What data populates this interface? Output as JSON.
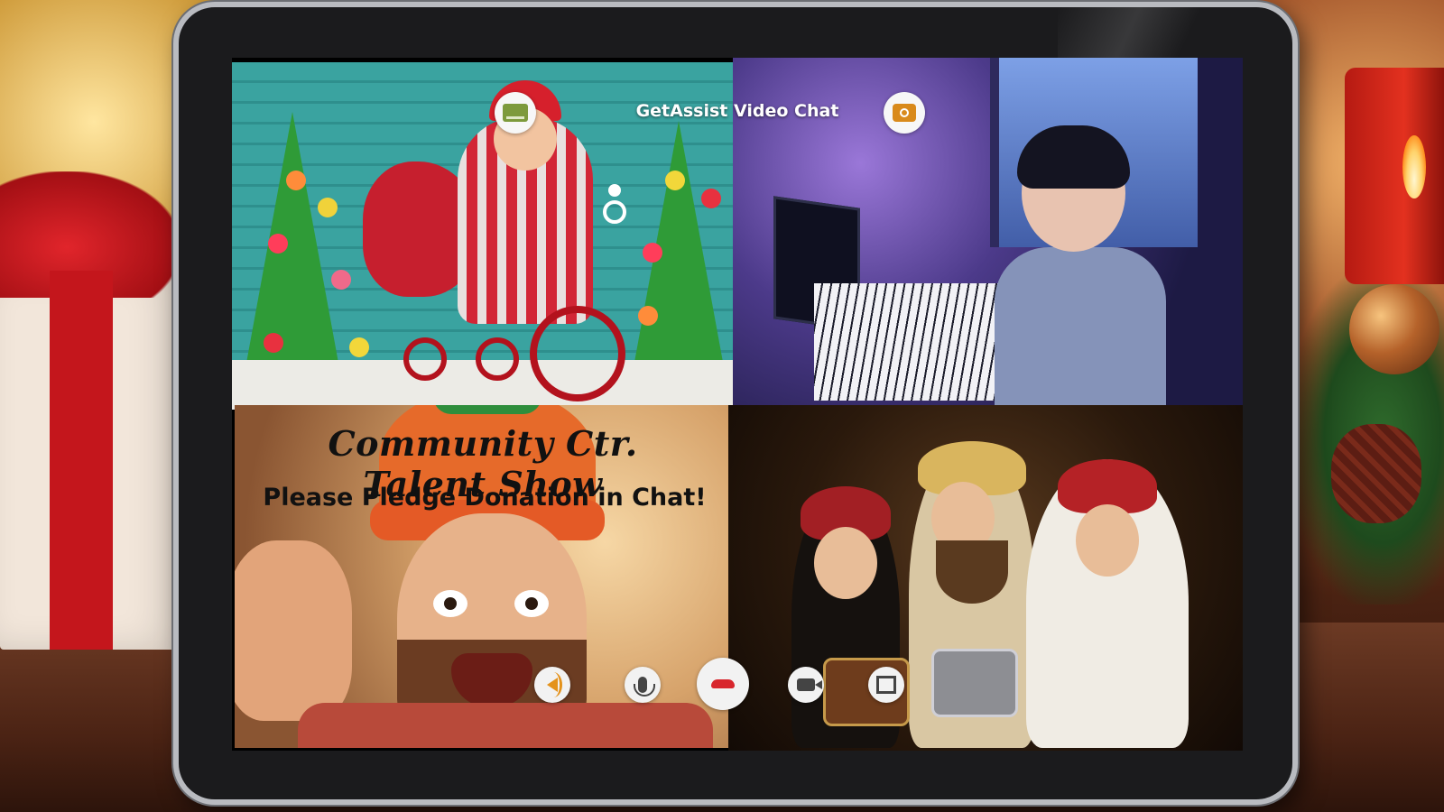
{
  "app": {
    "title": "GetAssist Video Chat"
  },
  "overlay": {
    "talent_title": "Community Ctr. Talent Show",
    "pledge_text": "Please Pledge Donation in Chat!"
  },
  "icons": {
    "layout": "grid-layout-icon",
    "flip_camera": "flip-camera-icon",
    "assist": "assist-logo-icon",
    "speaker": "speaker-icon",
    "mic": "microphone-icon",
    "hangup": "hang-up-icon",
    "camera": "video-camera-icon",
    "share": "screen-share-icon"
  },
  "colors": {
    "hangup": "#d8262d",
    "speaker": "#e4921b",
    "layout_icon": "#7d9a3c",
    "flip_icon": "#d98a1b"
  }
}
